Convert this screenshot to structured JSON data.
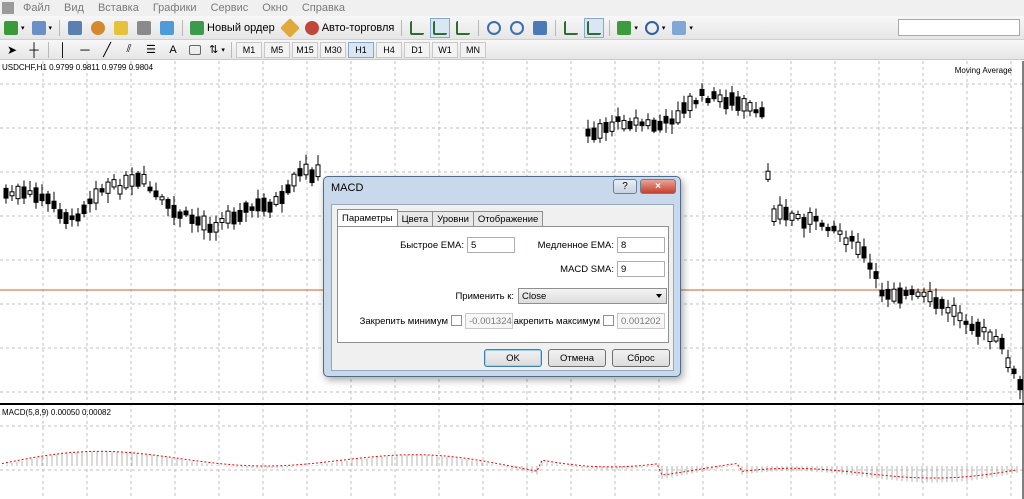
{
  "menu": {
    "items": [
      "Файл",
      "Вид",
      "Вставка",
      "Графики",
      "Сервис",
      "Окно",
      "Справка"
    ]
  },
  "toolbar": {
    "new_order": "Новый ордер",
    "auto_trading": "Авто-торговля",
    "text_tool": "A",
    "timeframes": [
      "M1",
      "M5",
      "M15",
      "M30",
      "H1",
      "H4",
      "D1",
      "W1",
      "MN"
    ],
    "search_placeholder": ""
  },
  "chart": {
    "symbol_label": "USDCHF,H1  0.9799 0.9811 0.9799 0.9804",
    "indicator_label": "Moving Average",
    "macd_label": "MACD(5,8,9) 0.00050 0.00082",
    "colors": {
      "candle": "#000000",
      "grid": "#c0c0c0",
      "hline": "#c86428",
      "signal": "#ff0000",
      "histogram": "#b4b4b4"
    },
    "chart_data": {
      "type": "candlestick",
      "symbol": "USDCHF",
      "timeframe": "H1",
      "ohlc": [
        0.9799,
        0.9811,
        0.9799,
        0.9804
      ],
      "indicators": [
        "Moving Average",
        "MACD(5,8,9)"
      ],
      "macd_values": [
        0.0005,
        0.00082
      ]
    }
  },
  "dialog": {
    "title": "MACD",
    "help": "?",
    "close": "×",
    "tabs": [
      "Параметры",
      "Цвета",
      "Уровни",
      "Отображение"
    ],
    "fast_ema_label": "Быстрое EMA:",
    "fast_ema_value": "5",
    "slow_ema_label": "Медленное EMA:",
    "slow_ema_value": "8",
    "macd_sma_label": "MACD SMA:",
    "macd_sma_value": "9",
    "apply_to_label": "Применить к:",
    "apply_to_value": "Close",
    "fix_min_label": "Закрепить минимум",
    "fix_min_value": "-0.001324",
    "fix_max_label": "акрепить максимум",
    "fix_max_value": "0.001202",
    "ok": "OK",
    "cancel": "Отмена",
    "reset": "Сброс"
  }
}
